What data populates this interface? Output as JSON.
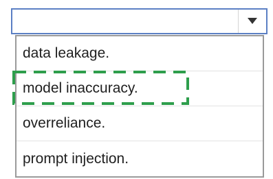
{
  "dropdown": {
    "selected_value": "",
    "toggle_icon": "chevron-down-icon",
    "options": [
      "data leakage.",
      "model inaccuracy.",
      "overreliance.",
      "prompt injection."
    ]
  },
  "colors": {
    "select_border": "#5b7fc4",
    "list_border": "#9a9a9a",
    "highlight_dash": "#2e9e4c",
    "text": "#1f1f1f"
  }
}
